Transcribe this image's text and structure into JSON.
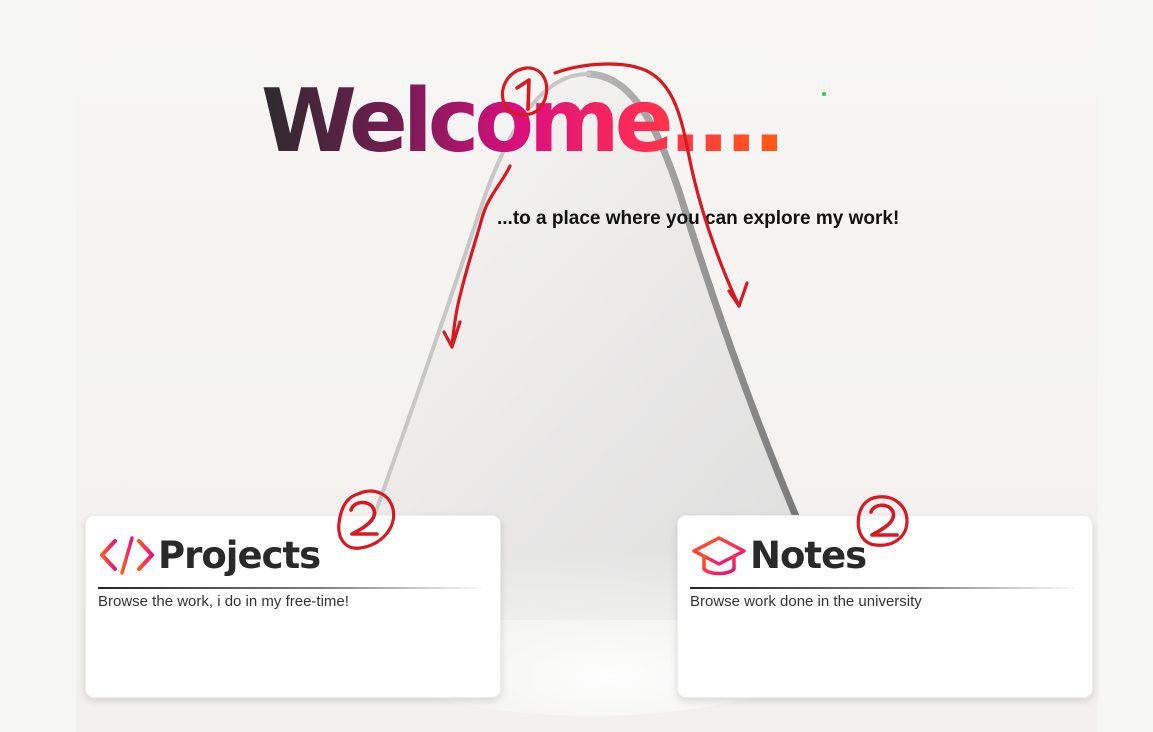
{
  "hero": {
    "title": "Welcome....",
    "subtitle": "...to a place where you can explore my work!"
  },
  "cards": [
    {
      "key": "projects",
      "title": "Projects",
      "description": "Browse the work, i do in my free-time!",
      "icon": "code-brackets-icon"
    },
    {
      "key": "notes",
      "title": "Notes",
      "description": "Browse work done in the university",
      "icon": "graduation-cap-icon"
    }
  ],
  "annotations": {
    "labels": [
      "1",
      "2",
      "2"
    ],
    "color": "#d71920"
  },
  "colors": {
    "background": "#f6f6f5",
    "card": "#ffffff",
    "title_gradient": [
      "#2c2b2d",
      "#7a1b55",
      "#dc0f7e",
      "#ff2d54",
      "#ff5a12"
    ],
    "accent": "#ff2d54",
    "indicator": "#28d03d"
  }
}
